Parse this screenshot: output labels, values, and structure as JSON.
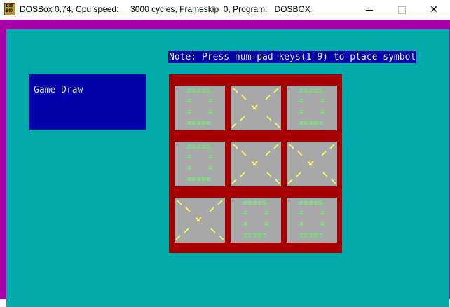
{
  "window": {
    "title": "DOSBox 0.74, Cpu speed:     3000 cycles, Frameskip  0, Program:   DOSBOX",
    "icon_text": "DOS BOX",
    "icon": "dosbox-icon",
    "minimize_icon": "minimize-icon",
    "maximize_icon": "maximize-icon",
    "close_icon": "close-icon",
    "close_glyph": "✕"
  },
  "game": {
    "note": "Note: Press num-pad keys(1-9) to place symbol",
    "status": "Game Draw",
    "board": [
      [
        "O",
        "X",
        "O"
      ],
      [
        "O",
        "X",
        "X"
      ],
      [
        "X",
        "O",
        "O"
      ]
    ]
  },
  "colors": {
    "border": "#a800a8",
    "screen": "#00aaaa",
    "panel": "#0000a8",
    "board": "#a80000",
    "cell": "#a8a8a8",
    "x_mark": "#ffff55",
    "o_mark": "#55ff55"
  }
}
